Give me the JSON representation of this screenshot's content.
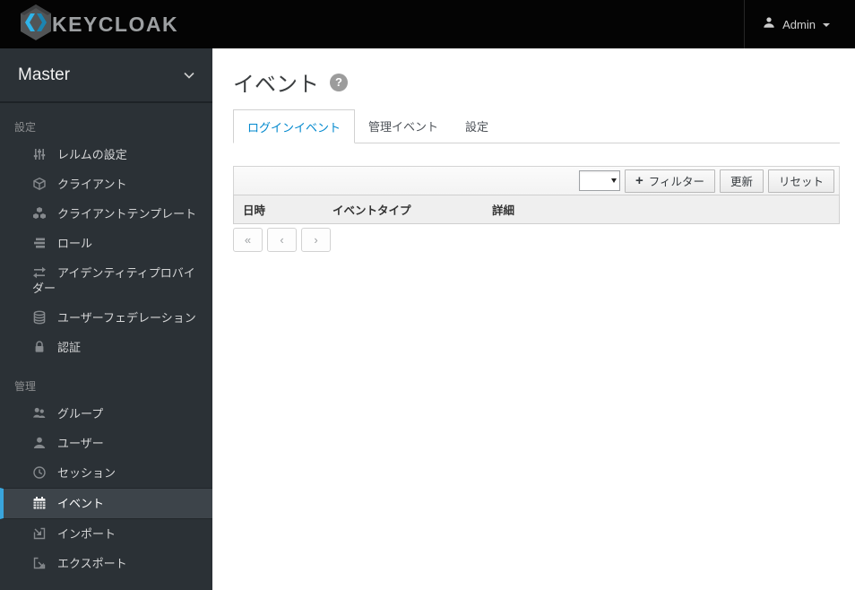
{
  "navbar": {
    "brand": "KEYCLOAK",
    "user_label": "Admin"
  },
  "sidebar": {
    "realm": "Master",
    "sections": [
      {
        "label": "設定",
        "items": [
          {
            "label": "レルムの設定",
            "icon": "sliders-icon"
          },
          {
            "label": "クライアント",
            "icon": "cube-icon"
          },
          {
            "label": "クライアントテンプレート",
            "icon": "cubes-icon"
          },
          {
            "label": "ロール",
            "icon": "roles-icon"
          },
          {
            "label": "アイデンティティプロバイダー",
            "icon": "exchange-arrows-icon"
          },
          {
            "label": "ユーザーフェデレーション",
            "icon": "database-icon"
          },
          {
            "label": "認証",
            "icon": "lock-icon"
          }
        ]
      },
      {
        "label": "管理",
        "items": [
          {
            "label": "グループ",
            "icon": "group-icon"
          },
          {
            "label": "ユーザー",
            "icon": "user-icon"
          },
          {
            "label": "セッション",
            "icon": "clock-icon"
          },
          {
            "label": "イベント",
            "icon": "calendar-icon",
            "active": true
          },
          {
            "label": "インポート",
            "icon": "import-icon"
          },
          {
            "label": "エクスポート",
            "icon": "export-icon"
          }
        ]
      }
    ]
  },
  "main": {
    "title": "イベント",
    "help_glyph": "?",
    "tabs": [
      {
        "label": "ログインイベント",
        "active": true
      },
      {
        "label": "管理イベント",
        "active": false
      },
      {
        "label": "設定",
        "active": false
      }
    ],
    "toolbar": {
      "select_value": "",
      "filter_button": "フィルター",
      "update_button": "更新",
      "reset_button": "リセット"
    },
    "table": {
      "columns": [
        "日時",
        "イベントタイプ",
        "詳細"
      ],
      "rows": []
    },
    "pagination": {
      "first": "«",
      "prev": "‹",
      "next": "›"
    }
  },
  "colors": {
    "navbar_bg": "#040404",
    "sidebar_bg": "#2b3136",
    "active_item_border": "#39a5dc",
    "active_tab_text": "#0088ce",
    "brand_blue": "#2fb4e9"
  }
}
